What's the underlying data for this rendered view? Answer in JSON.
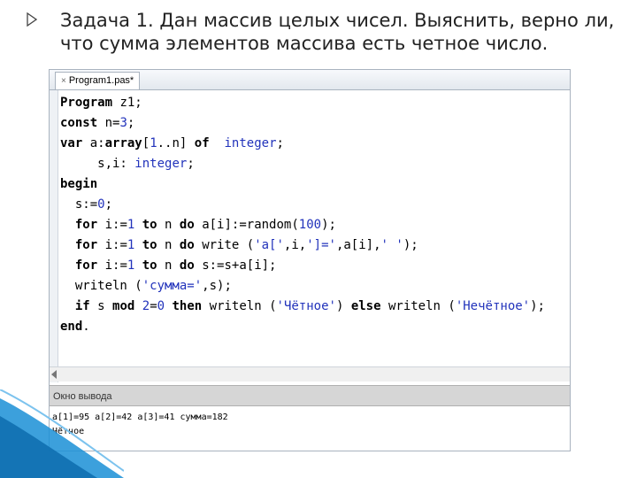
{
  "slide": {
    "title": "Задача 1. Дан массив целых чисел. Выяснить, верно ли, что сумма элементов массива есть четное число."
  },
  "ide": {
    "tab_label": "Program1.pas*",
    "tab_close_glyph": "×"
  },
  "code": {
    "l1_kw": "Program",
    "l1_rest": " z1;",
    "l2_kw": "const",
    "l2_a": " n=",
    "l2_num": "3",
    "l2_b": ";",
    "l3_kw1": "var",
    "l3_a": " a:",
    "l3_kw2": "array",
    "l3_b": "[",
    "l3_num": "1",
    "l3_c": "..n] ",
    "l3_kw3": "of",
    "l3_d": "  ",
    "l3_typ": "integer",
    "l3_e": ";",
    "l4_a": "     s,i: ",
    "l4_typ": "integer",
    "l4_b": ";",
    "l5_kw": "begin",
    "l6_a": "  s:=",
    "l6_num": "0",
    "l6_b": ";",
    "l7_pre": "  ",
    "l7_kw1": "for",
    "l7_a": " i:=",
    "l7_num1": "1",
    "l7_b": " ",
    "l7_kw2": "to",
    "l7_c": " n ",
    "l7_kw3": "do",
    "l7_d": " a[i]:=random(",
    "l7_num2": "100",
    "l7_e": ");",
    "l8_pre": "  ",
    "l8_kw1": "for",
    "l8_a": " i:=",
    "l8_num": "1",
    "l8_b": " ",
    "l8_kw2": "to",
    "l8_c": " n ",
    "l8_kw3": "do",
    "l8_d": " write (",
    "l8_str1": "'a['",
    "l8_e": ",i,",
    "l8_str2": "']='",
    "l8_f": ",a[i],",
    "l8_str3": "' '",
    "l8_g": ");",
    "l9_pre": "  ",
    "l9_kw1": "for",
    "l9_a": " i:=",
    "l9_num": "1",
    "l9_b": " ",
    "l9_kw2": "to",
    "l9_c": " n ",
    "l9_kw3": "do",
    "l9_d": " s:=s+a[i];",
    "l10_a": "  writeln (",
    "l10_str": "'сумма='",
    "l10_b": ",s);",
    "l11_pre": "  ",
    "l11_kw1": "if",
    "l11_a": " s ",
    "l11_kw2": "mod",
    "l11_b": " ",
    "l11_num": "2",
    "l11_c": "=",
    "l11_num2": "0",
    "l11_d": " ",
    "l11_kw3": "then",
    "l11_e": " writeln (",
    "l11_str1": "'Чётное'",
    "l11_f": ") ",
    "l11_kw4": "else",
    "l11_g": " writeln (",
    "l11_str2": "'Нечётное'",
    "l11_h": ");",
    "l12_kw": "end",
    "l12_rest": "."
  },
  "output": {
    "header": "Окно вывода",
    "line1": "a[1]=95 a[2]=42 a[3]=41 сумма=182",
    "line2": "Чётное"
  },
  "colors": {
    "keyword": "#000000",
    "literal": "#2233bb",
    "accent_swoosh": "#1a8fd6"
  }
}
